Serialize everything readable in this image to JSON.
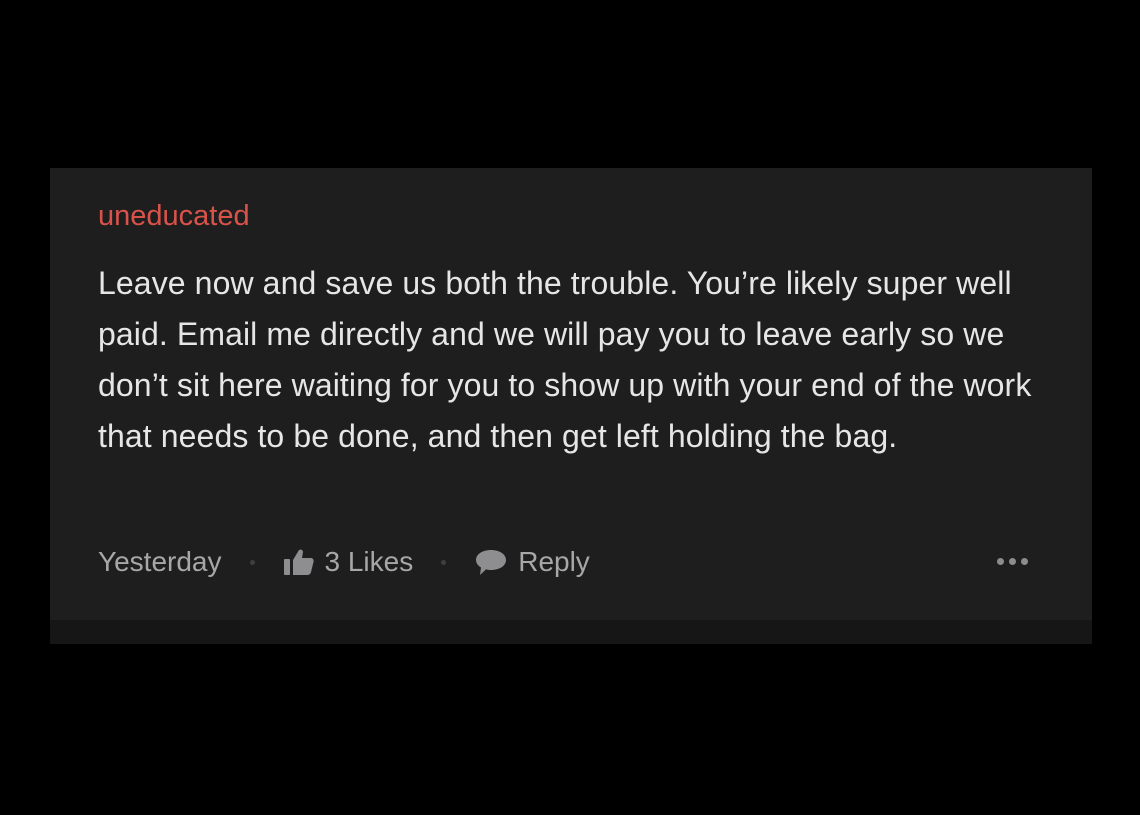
{
  "comment": {
    "username": "uneducated",
    "body": "Leave now and save us both the trouble. You’re likely super well paid. Email me directly and we will pay you to leave early so we don’t sit here waiting for you to show up with your end of the work that needs to be done, and then get left holding the bag.",
    "timestamp": "Yesterday",
    "likes_label": "3 Likes",
    "reply_label": "Reply"
  },
  "icons": {
    "like": "thumbs-up-icon",
    "reply": "speech-bubble-icon",
    "more": "ellipsis-icon"
  },
  "colors": {
    "background": "#000000",
    "card": "#1e1e1f",
    "username": "#d9534a",
    "body_text": "#e6e6e6",
    "meta_text": "#a7a7a8"
  }
}
